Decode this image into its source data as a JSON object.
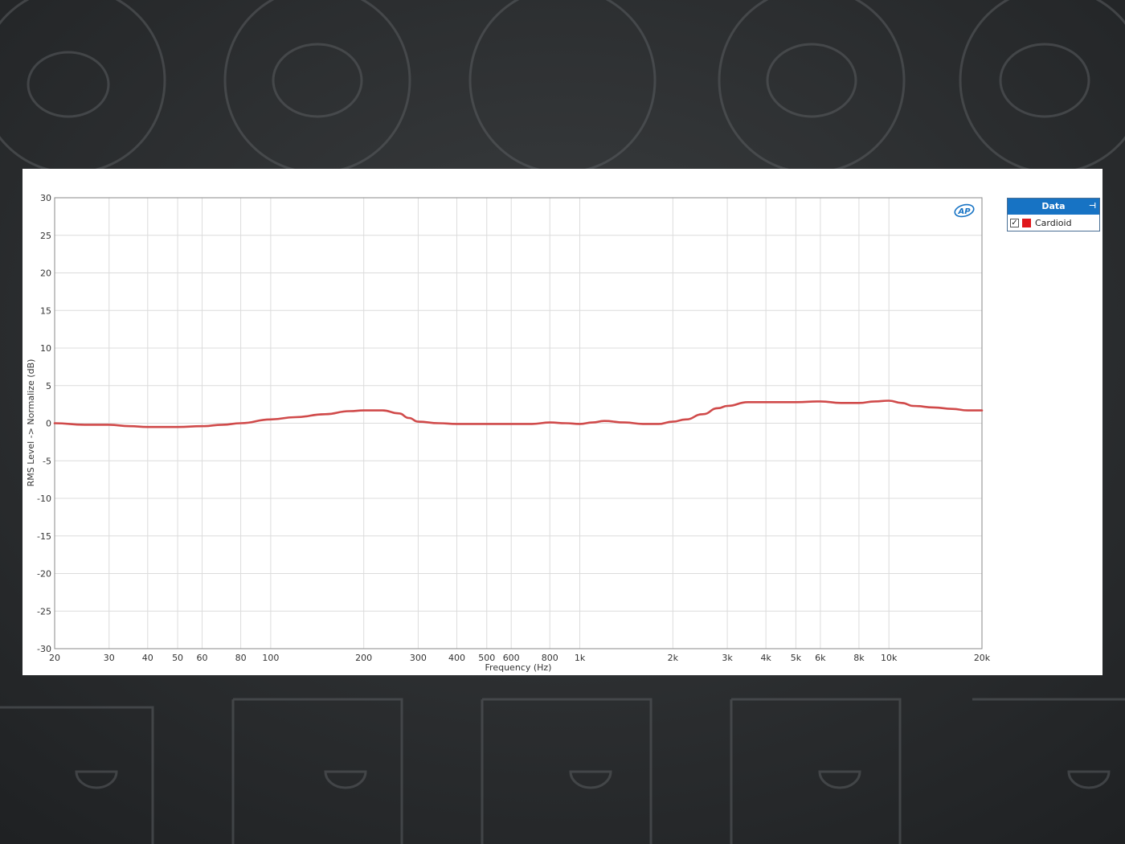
{
  "legend": {
    "header": "Data",
    "entries": [
      {
        "label": "Cardioid",
        "color": "#e0161b",
        "checked": true,
        "check_glyph": "✓"
      }
    ]
  },
  "logo_text": "AP",
  "colors": {
    "series": "#d04a4a",
    "grid": "#dcdcdc",
    "legend_header": "#1773c4"
  },
  "chart_data": {
    "type": "line",
    "xlabel": "Frequency (Hz)",
    "ylabel": "RMS Level -> Normalize (dB)",
    "x_scale": "log",
    "xlim": [
      20,
      20000
    ],
    "ylim": [
      -30,
      30
    ],
    "yticks": [
      30,
      25,
      20,
      15,
      10,
      5,
      0,
      -5,
      -10,
      -15,
      -20,
      -25,
      -30
    ],
    "ytick_labels": [
      "30",
      "25",
      "20",
      "15",
      "10",
      "5",
      "0",
      "-5",
      "-10",
      "-15",
      "-20",
      "-25",
      "-30"
    ],
    "xticks": [
      20,
      30,
      40,
      50,
      60,
      80,
      100,
      200,
      300,
      400,
      500,
      600,
      800,
      1000,
      2000,
      3000,
      4000,
      5000,
      6000,
      8000,
      10000,
      20000
    ],
    "xtick_labels": [
      "20",
      "30",
      "40",
      "50",
      "60",
      "80",
      "100",
      "200",
      "300",
      "400",
      "500",
      "600",
      "800",
      "1k",
      "2k",
      "3k",
      "4k",
      "5k",
      "6k",
      "8k",
      "10k",
      "20k"
    ],
    "grid": true,
    "legend_position": "right",
    "series": [
      {
        "name": "Cardioid",
        "x": [
          20,
          25,
          30,
          35,
          40,
          50,
          60,
          70,
          80,
          100,
          120,
          150,
          180,
          200,
          230,
          260,
          280,
          300,
          350,
          400,
          500,
          600,
          700,
          800,
          900,
          1000,
          1100,
          1200,
          1400,
          1600,
          1800,
          2000,
          2200,
          2500,
          2800,
          3000,
          3500,
          4000,
          5000,
          6000,
          7000,
          8000,
          9000,
          10000,
          11000,
          12000,
          14000,
          16000,
          18000,
          20000
        ],
        "y": [
          0.0,
          -0.2,
          -0.2,
          -0.4,
          -0.5,
          -0.5,
          -0.4,
          -0.2,
          0.0,
          0.5,
          0.8,
          1.2,
          1.6,
          1.7,
          1.7,
          1.3,
          0.7,
          0.2,
          0.0,
          -0.1,
          -0.1,
          -0.1,
          -0.1,
          0.1,
          0.0,
          -0.1,
          0.1,
          0.3,
          0.1,
          -0.1,
          -0.1,
          0.2,
          0.5,
          1.2,
          2.0,
          2.3,
          2.8,
          2.8,
          2.8,
          2.9,
          2.7,
          2.7,
          2.9,
          3.0,
          2.7,
          2.3,
          2.1,
          1.9,
          1.7,
          1.7
        ]
      }
    ]
  }
}
